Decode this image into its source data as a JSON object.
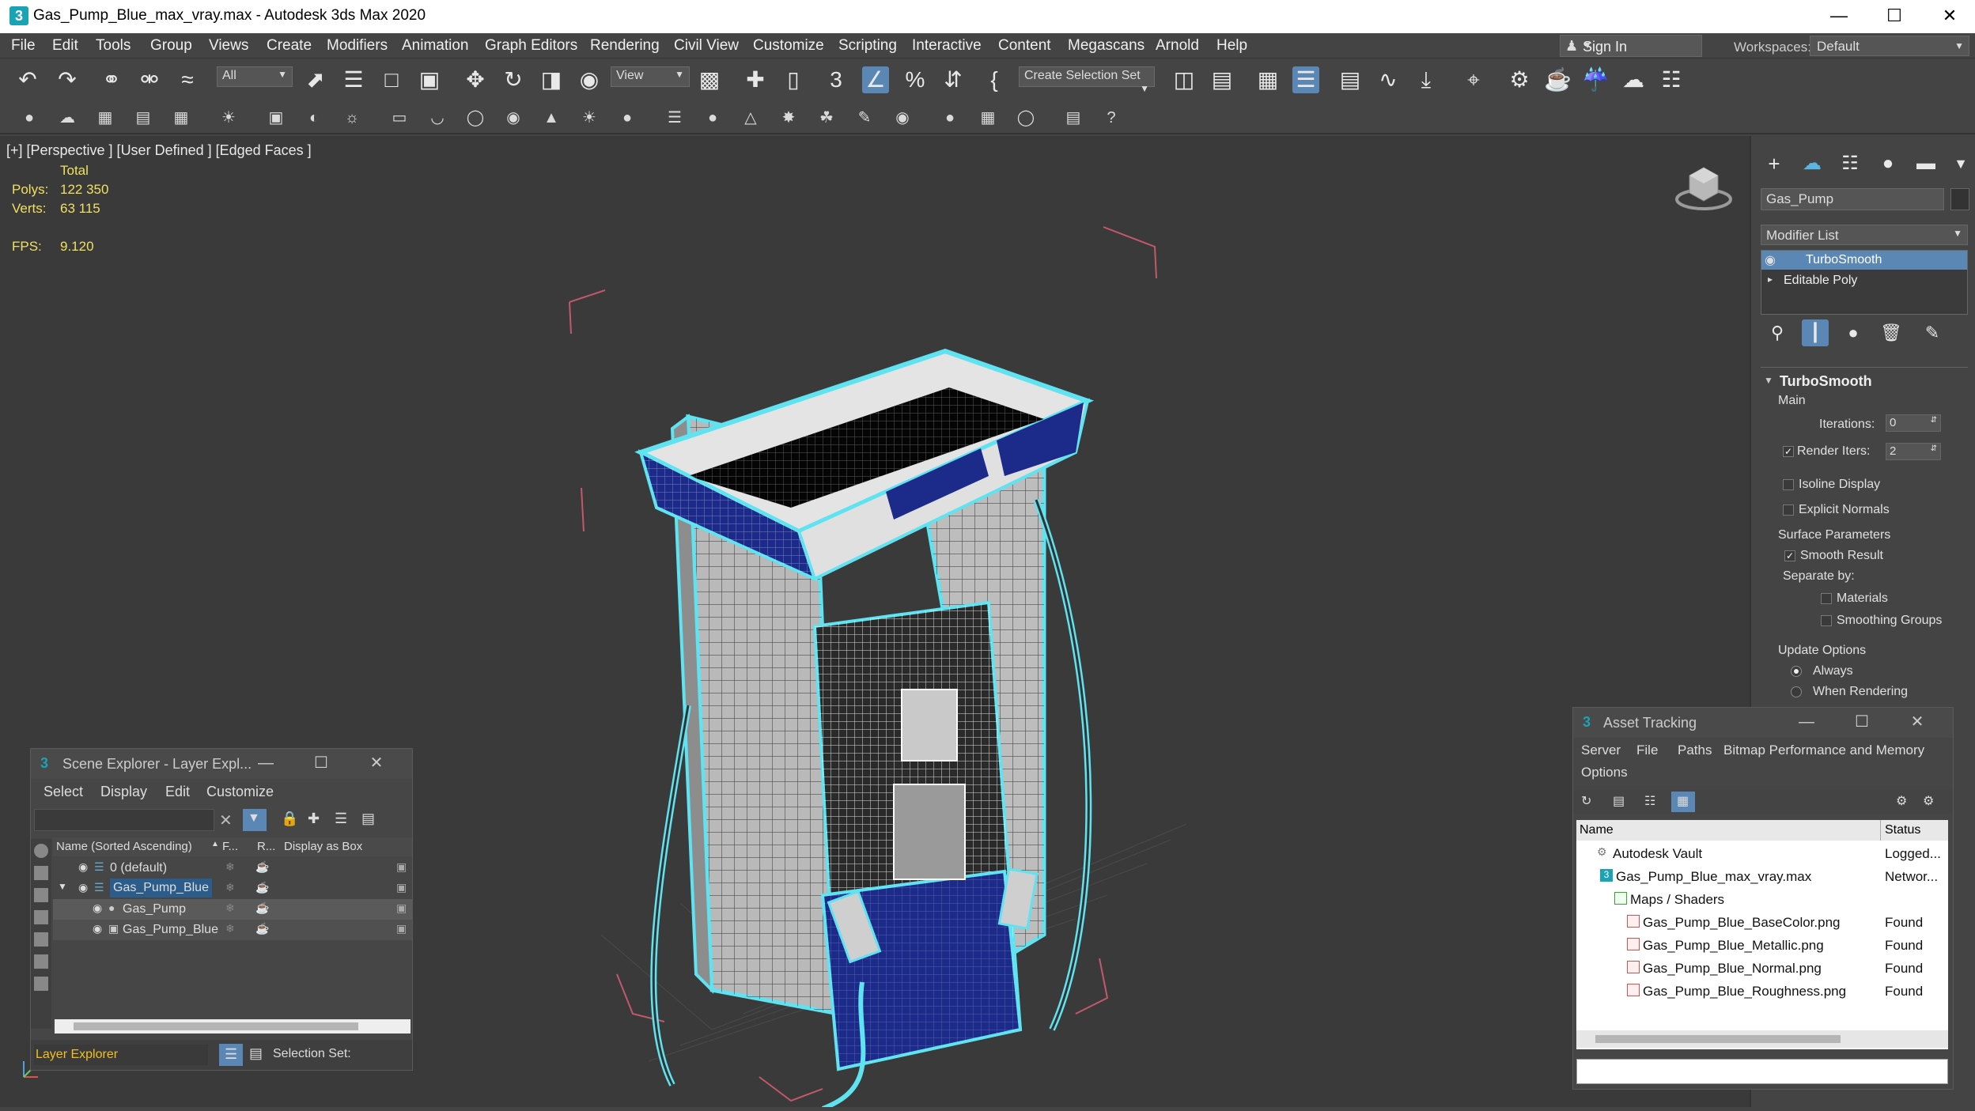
{
  "window": {
    "app_icon": "3",
    "title": "Gas_Pump_Blue_max_vray.max - Autodesk 3ds Max 2020",
    "minimize": "—",
    "maximize": "☐",
    "close": "✕"
  },
  "menu": [
    "File",
    "Edit",
    "Tools",
    "Group",
    "Views",
    "Create",
    "Modifiers",
    "Animation",
    "Graph Editors",
    "Rendering",
    "Civil View",
    "Customize",
    "Scripting",
    "Interactive",
    "Content",
    "Megascans",
    "Arnold",
    "Help"
  ],
  "signin": {
    "label": "Sign In"
  },
  "workspaces": {
    "label": "Workspaces:",
    "value": "Default"
  },
  "toolbar": {
    "filter_value": "All",
    "ref_coord_value": "View",
    "selection_set_value": "Create Selection Set"
  },
  "viewport": {
    "label": "[+] [Perspective ] [User Defined ] [Edged Faces ]",
    "stats": {
      "total_label": "Total",
      "polys_label": "Polys:",
      "polys_value": "122 350",
      "verts_label": "Verts:",
      "verts_value": "63 115",
      "fps_label": "FPS:",
      "fps_value": "9.120"
    }
  },
  "command_panel": {
    "object_name": "Gas_Pump",
    "modifier_list": "Modifier List",
    "stack": [
      "TurboSmooth",
      "Editable Poly"
    ],
    "turbosmooth": {
      "title": "TurboSmooth",
      "main": "Main",
      "iterations_label": "Iterations:",
      "iterations_value": "0",
      "render_iters_label": "Render Iters:",
      "render_iters_value": "2",
      "isoline": "Isoline Display",
      "explicit_normals": "Explicit Normals",
      "surface_params": "Surface Parameters",
      "smooth_result": "Smooth Result",
      "separate_by": "Separate by:",
      "materials": "Materials",
      "smoothing_groups": "Smoothing Groups",
      "update_options": "Update Options",
      "always": "Always",
      "when_rendering": "When Rendering"
    }
  },
  "scene_explorer": {
    "title": "Scene Explorer - Layer Expl...",
    "menu": [
      "Select",
      "Display",
      "Edit",
      "Customize"
    ],
    "columns": [
      "Name (Sorted Ascending)",
      "F...",
      "R...",
      "Display as Box"
    ],
    "rows": [
      {
        "name": "0 (default)"
      },
      {
        "name": "Gas_Pump_Blue"
      },
      {
        "name": "Gas_Pump"
      },
      {
        "name": "Gas_Pump_Blue"
      }
    ],
    "footer_mode": "Layer Explorer",
    "selection_set_label": "Selection Set:"
  },
  "asset_tracking": {
    "title": "Asset Tracking",
    "menu": [
      "Server",
      "File",
      "Paths",
      "Bitmap Performance and Memory",
      "Options"
    ],
    "columns": [
      "Name",
      "Status"
    ],
    "rows": [
      {
        "name": "Autodesk Vault",
        "status": "Logged..."
      },
      {
        "name": "Gas_Pump_Blue_max_vray.max",
        "status": "Networ..."
      },
      {
        "name": "Maps / Shaders",
        "status": ""
      },
      {
        "name": "Gas_Pump_Blue_BaseColor.png",
        "status": "Found"
      },
      {
        "name": "Gas_Pump_Blue_Metallic.png",
        "status": "Found"
      },
      {
        "name": "Gas_Pump_Blue_Normal.png",
        "status": "Found"
      },
      {
        "name": "Gas_Pump_Blue_Roughness.png",
        "status": "Found"
      }
    ]
  },
  "colors": {
    "accent": "#5b87b5",
    "stats_text": "#f0e060",
    "selection_outline": "#5fe3f0",
    "pump_blue": "#1c2a8a",
    "layer_explorer_label": "#f0c020"
  }
}
